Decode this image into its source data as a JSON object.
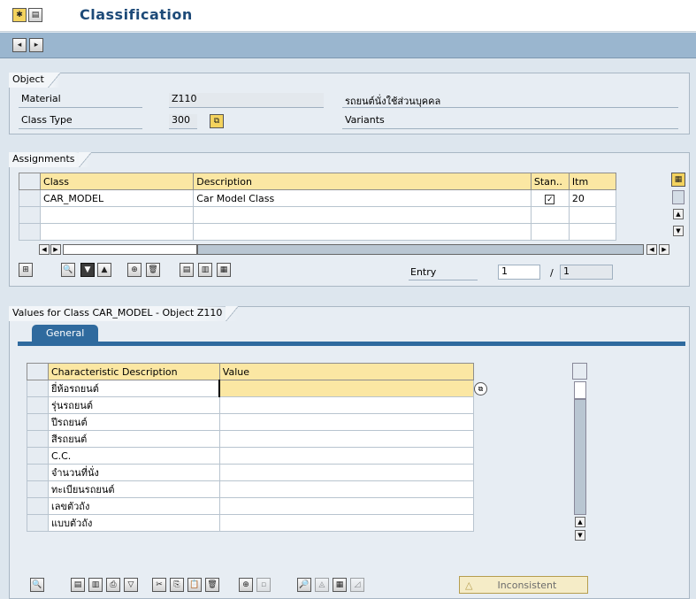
{
  "window": {
    "title": "Classification"
  },
  "object_group": {
    "title": "Object",
    "material_label": "Material",
    "material_value": "Z110",
    "material_desc": "รถยนต์นั่งใช้ส่วนบุคคล",
    "class_type_label": "Class Type",
    "class_type_value": "300",
    "class_type_desc": "Variants"
  },
  "assignments": {
    "title": "Assignments",
    "columns": [
      "Class",
      "Description",
      "Stan..",
      "Itm"
    ],
    "rows": [
      {
        "class": "CAR_MODEL",
        "description": "Car Model Class",
        "standard": true,
        "item": "20"
      }
    ],
    "entry_label": "Entry",
    "entry_current": "1",
    "entry_sep": "/",
    "entry_total": "1"
  },
  "values": {
    "title": "Values for Class CAR_MODEL - Object Z110",
    "tab": "General",
    "columns": [
      "Characteristic Description",
      "Value"
    ],
    "rows": [
      {
        "desc": "ยี่ห้อรถยนต์",
        "value": ""
      },
      {
        "desc": "รุ่นรถยนต์",
        "value": ""
      },
      {
        "desc": "ปีรถยนต์",
        "value": ""
      },
      {
        "desc": "สีรถยนต์",
        "value": ""
      },
      {
        "desc": "C.C.",
        "value": ""
      },
      {
        "desc": "จำนวนที่นั่ง",
        "value": ""
      },
      {
        "desc": "ทะเบียนรถยนต์",
        "value": ""
      },
      {
        "desc": "เลขตัวถัง",
        "value": ""
      },
      {
        "desc": "แบบตัวถัง",
        "value": ""
      }
    ],
    "status_button": "Inconsistent"
  },
  "colors": {
    "title_blue": "#1d4a78",
    "header_yellow": "#fbe7a3",
    "tab_blue": "#2f6a9e",
    "toolbar": "#9ab6cf"
  }
}
